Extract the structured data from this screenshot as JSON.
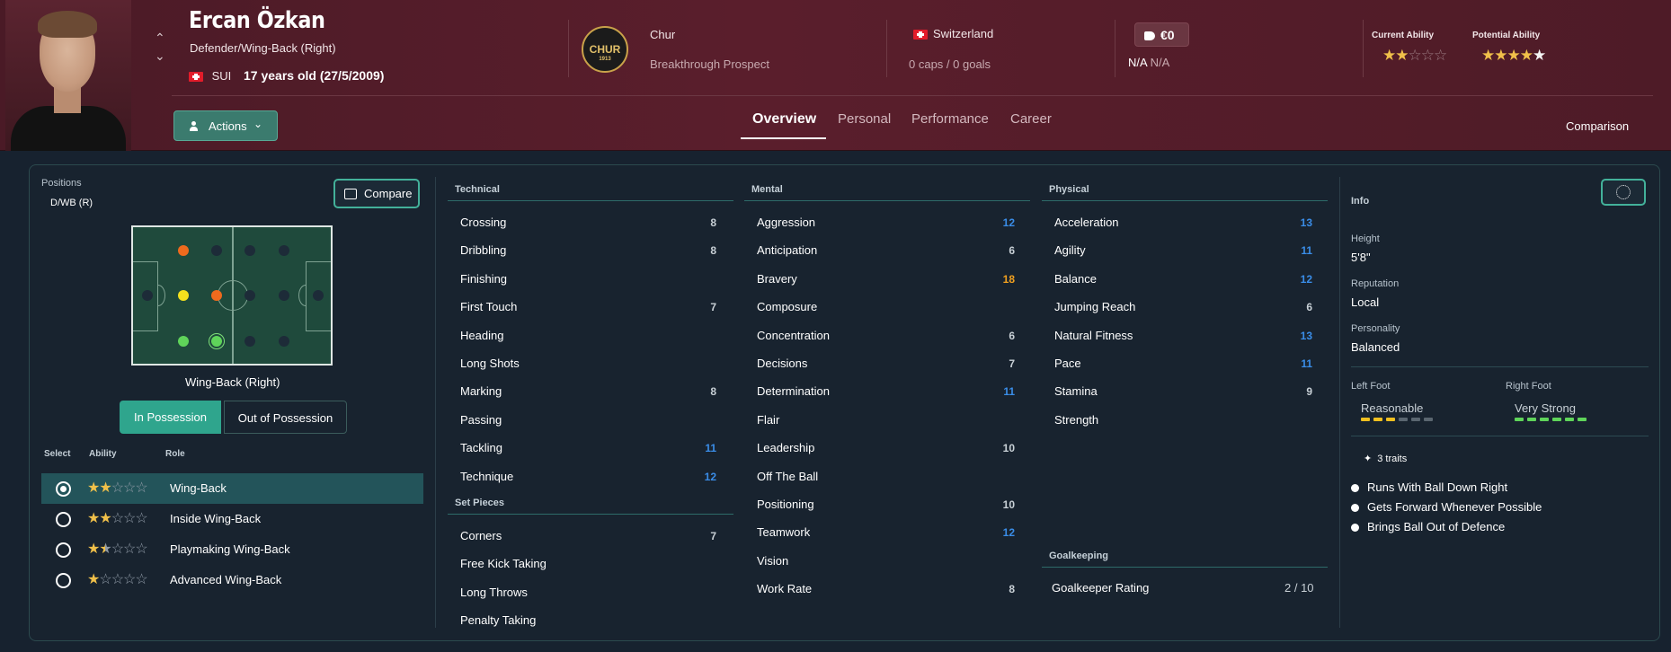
{
  "player": {
    "name": "Ercan Özkan",
    "position": "Defender/Wing-Back (Right)",
    "nationality_code": "SUI",
    "age": "17 years old (27/5/2009)"
  },
  "club": {
    "badge_text": "CHUR",
    "badge_year": "1913",
    "name": "Chur",
    "status": "Breakthrough Prospect"
  },
  "international": {
    "country": "Switzerland",
    "caps": "0 caps / 0 goals"
  },
  "contract": {
    "value": "€0",
    "wage": "N/A",
    "wage_detail": "N/A"
  },
  "ability": {
    "current_label": "Current Ability",
    "current_stars": 2,
    "potential_label": "Potential Ability",
    "potential_stars": 4.5
  },
  "toolbar": {
    "actions_label": "Actions",
    "tabs": [
      "Overview",
      "Personal",
      "Performance",
      "Career"
    ],
    "active_tab": "Overview",
    "comparison_label": "Comparison"
  },
  "positions": {
    "label": "Positions",
    "value": "D/WB (R)",
    "compare_label": "Compare",
    "role_title": "Wing-Back (Right)",
    "in_possession": "In Possession",
    "out_of_possession": "Out of Possession",
    "headers": {
      "select": "Select",
      "ability": "Ability",
      "role": "Role"
    },
    "roles": [
      {
        "name": "Wing-Back",
        "stars": 2,
        "selected": true
      },
      {
        "name": "Inside Wing-Back",
        "stars": 2,
        "selected": false
      },
      {
        "name": "Playmaking Wing-Back",
        "stars": 1.5,
        "selected": false
      },
      {
        "name": "Advanced Wing-Back",
        "stars": 1,
        "selected": false
      }
    ]
  },
  "attributes": {
    "technical_title": "Technical",
    "technical": [
      {
        "name": "Crossing",
        "value": "8",
        "tone": "grey"
      },
      {
        "name": "Dribbling",
        "value": "8",
        "tone": "grey"
      },
      {
        "name": "Finishing",
        "value": "",
        "tone": "grey"
      },
      {
        "name": "First Touch",
        "value": "7",
        "tone": "grey"
      },
      {
        "name": "Heading",
        "value": "",
        "tone": "grey"
      },
      {
        "name": "Long Shots",
        "value": "",
        "tone": "grey"
      },
      {
        "name": "Marking",
        "value": "8",
        "tone": "grey"
      },
      {
        "name": "Passing",
        "value": "",
        "tone": "grey"
      },
      {
        "name": "Tackling",
        "value": "11",
        "tone": "blue"
      },
      {
        "name": "Technique",
        "value": "12",
        "tone": "blue"
      }
    ],
    "set_pieces_title": "Set Pieces",
    "set_pieces": [
      {
        "name": "Corners",
        "value": "7",
        "tone": "grey"
      },
      {
        "name": "Free Kick Taking",
        "value": "",
        "tone": "grey"
      },
      {
        "name": "Long Throws",
        "value": "",
        "tone": "grey"
      },
      {
        "name": "Penalty Taking",
        "value": "",
        "tone": "grey"
      }
    ],
    "mental_title": "Mental",
    "mental": [
      {
        "name": "Aggression",
        "value": "12",
        "tone": "blue"
      },
      {
        "name": "Anticipation",
        "value": "6",
        "tone": "grey"
      },
      {
        "name": "Bravery",
        "value": "18",
        "tone": "orange"
      },
      {
        "name": "Composure",
        "value": "",
        "tone": "grey"
      },
      {
        "name": "Concentration",
        "value": "6",
        "tone": "grey"
      },
      {
        "name": "Decisions",
        "value": "7",
        "tone": "grey"
      },
      {
        "name": "Determination",
        "value": "11",
        "tone": "blue"
      },
      {
        "name": "Flair",
        "value": "",
        "tone": "grey"
      },
      {
        "name": "Leadership",
        "value": "10",
        "tone": "grey"
      },
      {
        "name": "Off The Ball",
        "value": "",
        "tone": "grey"
      },
      {
        "name": "Positioning",
        "value": "10",
        "tone": "grey"
      },
      {
        "name": "Teamwork",
        "value": "12",
        "tone": "blue"
      },
      {
        "name": "Vision",
        "value": "",
        "tone": "grey"
      },
      {
        "name": "Work Rate",
        "value": "8",
        "tone": "grey"
      }
    ],
    "physical_title": "Physical",
    "physical": [
      {
        "name": "Acceleration",
        "value": "13",
        "tone": "blue"
      },
      {
        "name": "Agility",
        "value": "11",
        "tone": "blue"
      },
      {
        "name": "Balance",
        "value": "12",
        "tone": "blue"
      },
      {
        "name": "Jumping Reach",
        "value": "6",
        "tone": "grey"
      },
      {
        "name": "Natural Fitness",
        "value": "13",
        "tone": "blue"
      },
      {
        "name": "Pace",
        "value": "11",
        "tone": "blue"
      },
      {
        "name": "Stamina",
        "value": "9",
        "tone": "grey"
      },
      {
        "name": "Strength",
        "value": "",
        "tone": "grey"
      }
    ],
    "goalkeeping_title": "Goalkeeping",
    "gk_rating_label": "Goalkeeper Rating",
    "gk_rating_value": "2 / 10"
  },
  "info": {
    "title": "Info",
    "height_label": "Height",
    "height": "5'8\"",
    "reputation_label": "Reputation",
    "reputation": "Local",
    "personality_label": "Personality",
    "personality": "Balanced",
    "left_foot_label": "Left Foot",
    "left_foot": "Reasonable",
    "left_foot_level": 3,
    "right_foot_label": "Right Foot",
    "right_foot": "Very Strong",
    "right_foot_level": 6,
    "traits_count": "3 traits",
    "traits": [
      "Runs With Ball Down Right",
      "Gets Forward Whenever Possible",
      "Brings Ball Out of Defence"
    ]
  },
  "colors": {
    "accent": "#2fa58d",
    "header_bg": "#5a1e2c",
    "attr_blue": "#3a8de8",
    "attr_orange": "#f0a020",
    "star": "#f0c04a"
  }
}
